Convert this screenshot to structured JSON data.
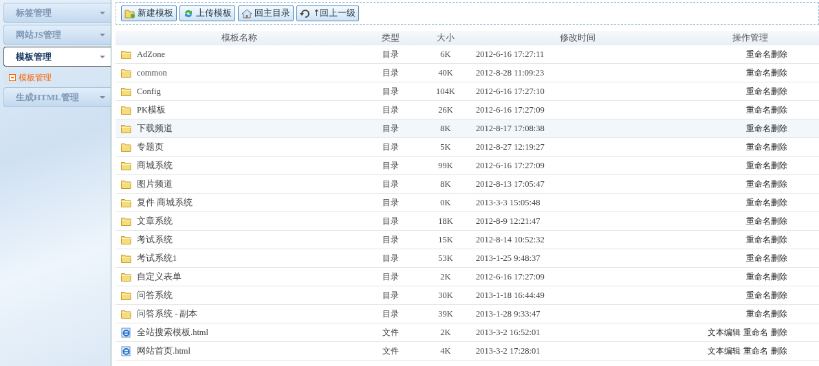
{
  "sidebar": {
    "items": [
      {
        "label": "标签管理",
        "expanded": false
      },
      {
        "label": "网站JS管理",
        "expanded": false
      },
      {
        "label": "模板管理",
        "expanded": true,
        "children": [
          {
            "label": "模板管理",
            "selected": true
          }
        ]
      },
      {
        "label": "生成HTML管理",
        "expanded": false
      }
    ]
  },
  "toolbar": {
    "buttons": [
      {
        "label": "新建模板",
        "kind": "new-folder"
      },
      {
        "label": "上传模板",
        "kind": "upload"
      },
      {
        "label": "回主目录",
        "kind": "home"
      },
      {
        "label": "↑回上一级",
        "kind": "up"
      }
    ]
  },
  "table": {
    "columns": [
      "模板名称",
      "类型",
      "大小",
      "修改时间",
      "操作管理"
    ],
    "rows": [
      {
        "kind": "folder",
        "name": "AdZone",
        "type": "目录",
        "size": "6K",
        "modified": "2012-6-16 17:27:11",
        "actions": [
          "重命名",
          "删除"
        ],
        "selected": false
      },
      {
        "kind": "folder",
        "name": "common",
        "type": "目录",
        "size": "40K",
        "modified": "2012-8-28 11:09:23",
        "actions": [
          "重命名",
          "删除"
        ],
        "selected": false
      },
      {
        "kind": "folder",
        "name": "Config",
        "type": "目录",
        "size": "104K",
        "modified": "2012-6-16 17:27:10",
        "actions": [
          "重命名",
          "删除"
        ],
        "selected": false
      },
      {
        "kind": "folder",
        "name": "PK模板",
        "type": "目录",
        "size": "26K",
        "modified": "2012-6-16 17:27:09",
        "actions": [
          "重命名",
          "删除"
        ],
        "selected": false
      },
      {
        "kind": "folder",
        "name": "下载频道",
        "type": "目录",
        "size": "8K",
        "modified": "2012-8-17 17:08:38",
        "actions": [
          "重命名",
          "删除"
        ],
        "selected": true
      },
      {
        "kind": "folder",
        "name": "专题页",
        "type": "目录",
        "size": "5K",
        "modified": "2012-8-27 12:19:27",
        "actions": [
          "重命名",
          "删除"
        ],
        "selected": false
      },
      {
        "kind": "folder",
        "name": "商城系统",
        "type": "目录",
        "size": "99K",
        "modified": "2012-6-16 17:27:09",
        "actions": [
          "重命名",
          "删除"
        ],
        "selected": false
      },
      {
        "kind": "folder",
        "name": "图片频道",
        "type": "目录",
        "size": "8K",
        "modified": "2012-8-13 17:05:47",
        "actions": [
          "重命名",
          "删除"
        ],
        "selected": false
      },
      {
        "kind": "folder",
        "name": "复件 商城系统",
        "type": "目录",
        "size": "0K",
        "modified": "2013-3-3 15:05:48",
        "actions": [
          "重命名",
          "删除"
        ],
        "selected": false
      },
      {
        "kind": "folder",
        "name": "文章系统",
        "type": "目录",
        "size": "18K",
        "modified": "2012-8-9 12:21:47",
        "actions": [
          "重命名",
          "删除"
        ],
        "selected": false
      },
      {
        "kind": "folder",
        "name": "考试系统",
        "type": "目录",
        "size": "15K",
        "modified": "2012-8-14 10:52:32",
        "actions": [
          "重命名",
          "删除"
        ],
        "selected": false
      },
      {
        "kind": "folder",
        "name": "考试系统1",
        "type": "目录",
        "size": "53K",
        "modified": "2013-1-25 9:48:37",
        "actions": [
          "重命名",
          "删除"
        ],
        "selected": false
      },
      {
        "kind": "folder",
        "name": "自定义表单",
        "type": "目录",
        "size": "2K",
        "modified": "2012-6-16 17:27:09",
        "actions": [
          "重命名",
          "删除"
        ],
        "selected": false
      },
      {
        "kind": "folder",
        "name": "问答系统",
        "type": "目录",
        "size": "30K",
        "modified": "2013-1-18 16:44:49",
        "actions": [
          "重命名",
          "删除"
        ],
        "selected": false
      },
      {
        "kind": "folder",
        "name": "问答系统 - 副本",
        "type": "目录",
        "size": "39K",
        "modified": "2013-1-28 9:33:47",
        "actions": [
          "重命名",
          "删除"
        ],
        "selected": false
      },
      {
        "kind": "file",
        "name": "全站搜索模板.html",
        "type": "文件",
        "size": "2K",
        "modified": "2013-3-2 16:52:01",
        "actions": [
          "文本编辑",
          "重命名",
          "删除"
        ],
        "selected": false
      },
      {
        "kind": "file",
        "name": "网站首页.html",
        "type": "文件",
        "size": "4K",
        "modified": "2013-3-2 17:28:01",
        "actions": [
          "文本编辑",
          "重命名",
          "删除"
        ],
        "selected": false
      }
    ]
  }
}
